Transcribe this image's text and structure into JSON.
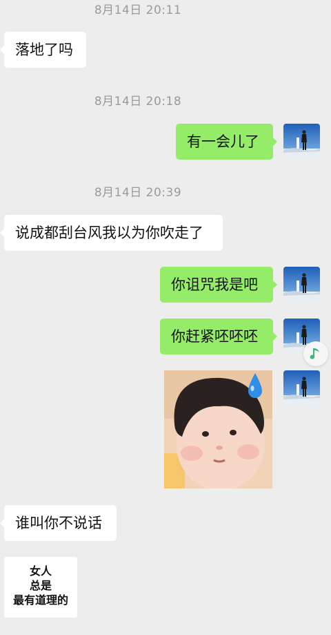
{
  "timestamps": [
    "8月14日 20:11",
    "8月14日 20:18",
    "8月14日 20:39"
  ],
  "messages": {
    "m1": "落地了吗",
    "m2": "有一会儿了",
    "m3": "说成都刮台风我以为你吹走了",
    "m4": "你诅咒我是吧",
    "m5": "你赶紧呸呸呸",
    "m6": "谁叫你不说话"
  },
  "card": {
    "line1": "女人",
    "line2": "总是",
    "line3": "最有道理的"
  },
  "colors": {
    "background": "#ededed",
    "sent_bubble": "#95ec69",
    "received_bubble": "#ffffff",
    "timestamp": "#9a9a9a"
  },
  "icons": {
    "music": "music-note-icon"
  }
}
